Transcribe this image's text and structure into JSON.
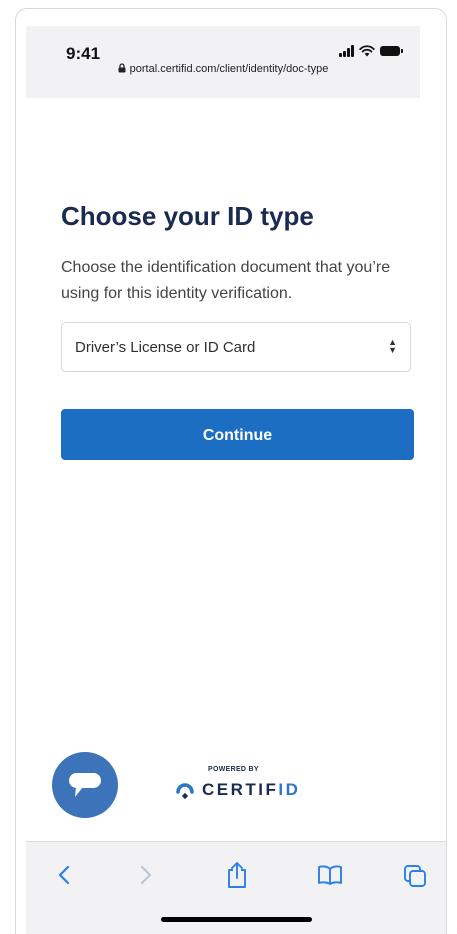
{
  "status_bar": {
    "time": "9:41",
    "url": "portal.certifid.com/client/identity/doc-type",
    "icons": [
      "signal-icon",
      "wifi-icon",
      "battery-icon",
      "lock-icon"
    ]
  },
  "main": {
    "title": "Choose your ID type",
    "description": "Choose the identification document that you’re using for this identity verification.",
    "id_type_select": {
      "selected": "Driver’s License or ID Card"
    },
    "continue_label": "Continue"
  },
  "footer": {
    "powered_by": "POWERED BY",
    "brand_prefix": "CERTIF",
    "brand_suffix": "ID",
    "chat_icon": "chat-bubble-icon"
  },
  "browser_toolbar": {
    "icons": [
      "back-icon",
      "forward-icon",
      "share-icon",
      "bookmarks-icon",
      "tabs-icon"
    ]
  },
  "colors": {
    "primary_button": "#1b6ec2",
    "heading": "#1b2b4f",
    "chat_bubble": "#3d73b9",
    "brand_accent": "#2f77c3",
    "browser_icons": "#2b7fe6"
  }
}
